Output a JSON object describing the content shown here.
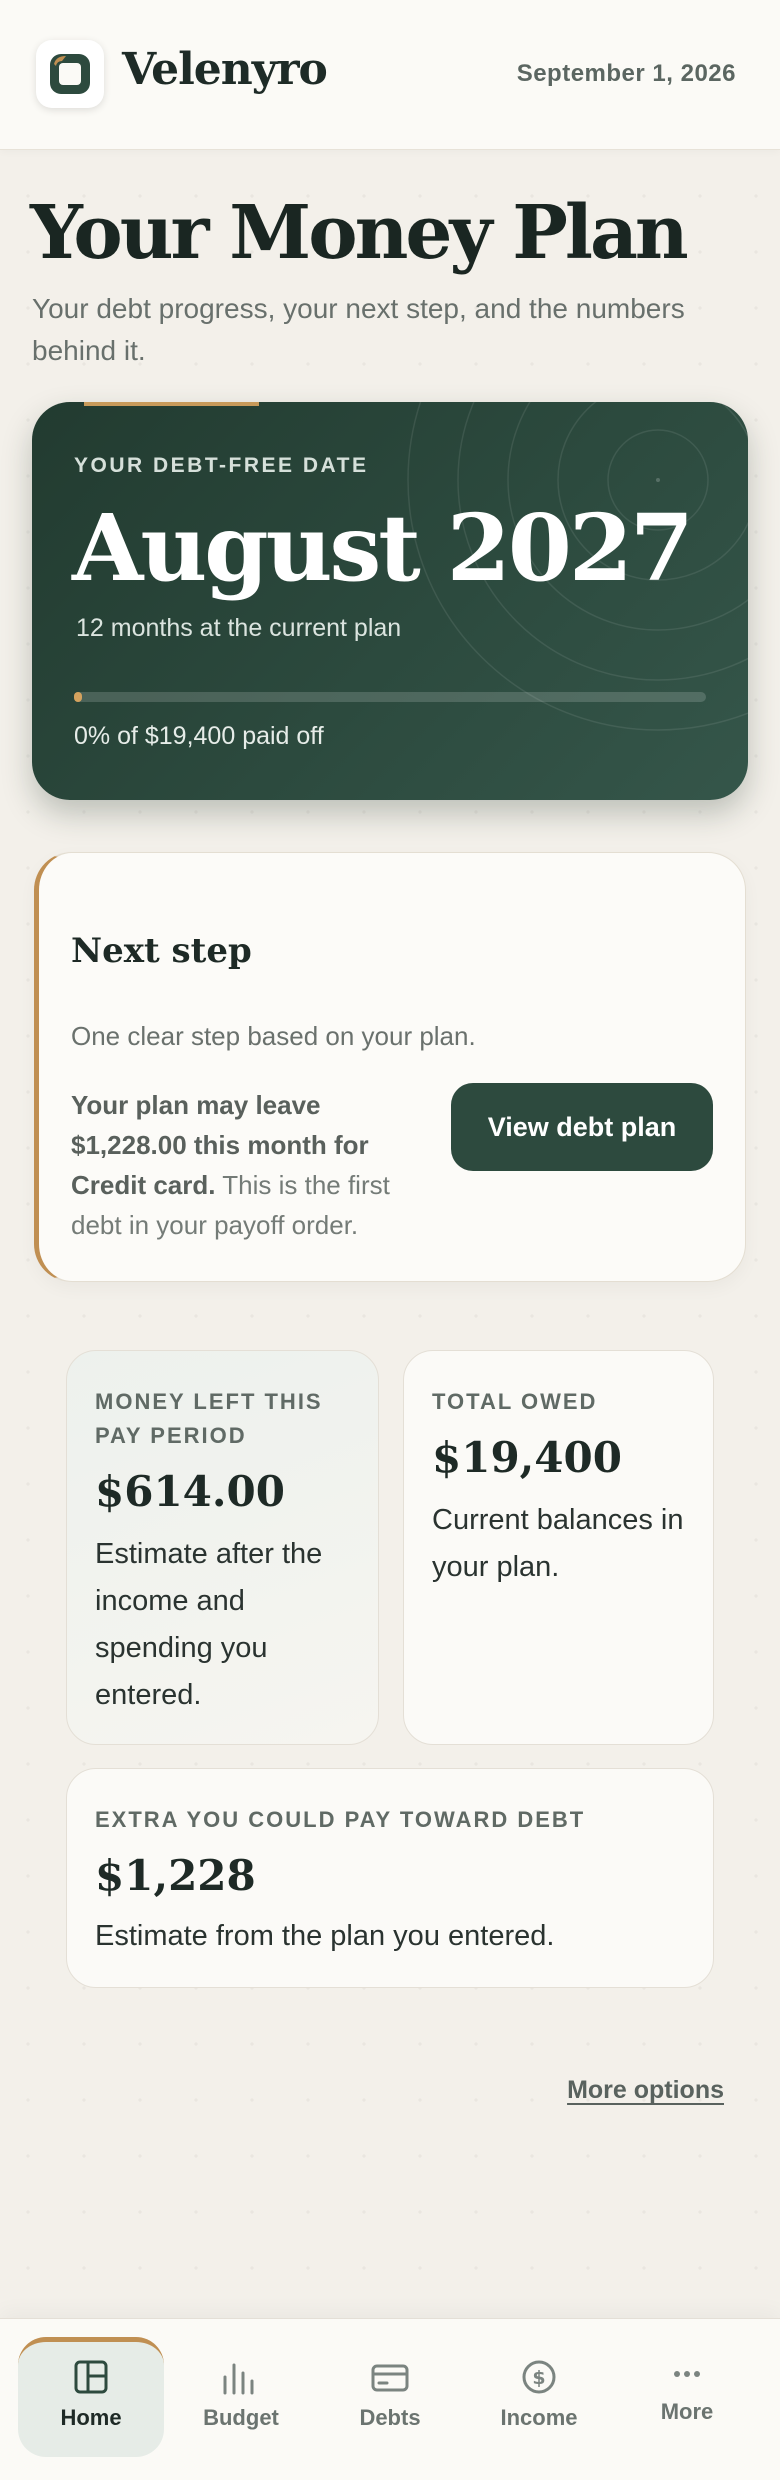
{
  "header": {
    "brand": "Velenyro",
    "date": "September 1, 2026"
  },
  "page": {
    "title": "Your Money Plan",
    "subtitle": "Your debt progress, your next step, and the numbers behind it."
  },
  "hero": {
    "label": "YOUR DEBT-FREE DATE",
    "date": "August 2027",
    "months_note": "12 months at the current plan",
    "progress_percent": 0,
    "paid_text": "0% of $19,400 paid off"
  },
  "next_step": {
    "title": "Next step",
    "description": "One clear step based on your plan.",
    "body_bold": "Your plan may leave $1,228.00 this month for Credit card.",
    "body_rest": " This is the first debt in your payoff order.",
    "button_label": "View debt plan"
  },
  "stats": {
    "money_left": {
      "label": "MONEY LEFT THIS PAY PERIOD",
      "value": "$614.00",
      "note": "Estimate after the income and spending you entered."
    },
    "total_owed": {
      "label": "TOTAL OWED",
      "value": "$19,400",
      "note": "Current balances in your plan."
    },
    "extra_pay": {
      "label": "EXTRA YOU COULD PAY TOWARD DEBT",
      "value": "$1,228",
      "note": "Estimate from the plan you entered."
    }
  },
  "more_options": "More options",
  "nav": [
    {
      "label": "Home",
      "icon": "home-icon",
      "active": true
    },
    {
      "label": "Budget",
      "icon": "bar-chart-icon",
      "active": false
    },
    {
      "label": "Debts",
      "icon": "credit-card-icon",
      "active": false
    },
    {
      "label": "Income",
      "icon": "dollar-circle-icon",
      "active": false
    },
    {
      "label": "More",
      "icon": "more-dots-icon",
      "active": false
    }
  ],
  "colors": {
    "brand_green": "#2d4a3e",
    "accent_gold": "#c08f52",
    "background": "#f3f0ea"
  }
}
